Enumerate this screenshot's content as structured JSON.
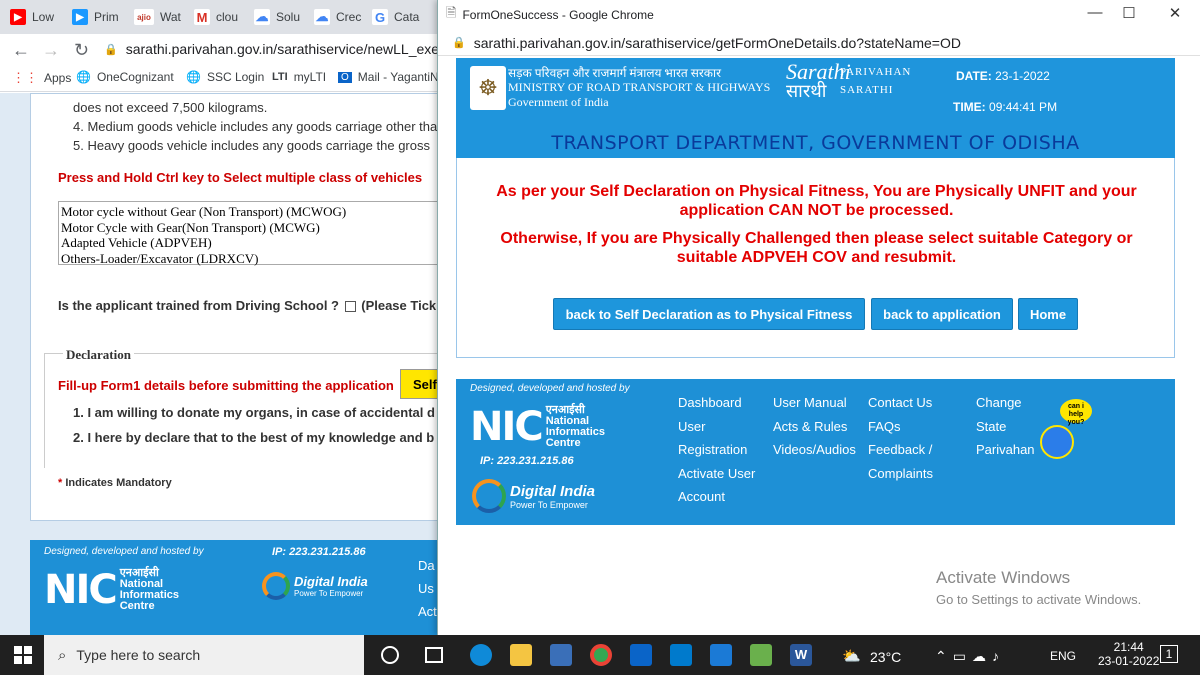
{
  "background_browser": {
    "tabs": [
      {
        "label": "Low",
        "icon": "youtube-icon",
        "color": "#ff0000"
      },
      {
        "label": "Prim",
        "icon": "prime-icon",
        "color": "#1a98ff"
      },
      {
        "label": "Wat",
        "icon": "ajio-icon",
        "color": "#c0392b"
      },
      {
        "label": "clou",
        "icon": "gmail-icon",
        "color": "#d93025"
      },
      {
        "label": "Solu",
        "icon": "cloud-icon",
        "color": "#4285f4"
      },
      {
        "label": "Crec",
        "icon": "cloud-icon",
        "color": "#4285f4"
      },
      {
        "label": "Cata",
        "icon": "google-icon",
        "color": "#4285f4"
      }
    ],
    "url": "sarathi.parivahan.gov.in/sarathiservice/newLL_execut",
    "bookmarks": [
      {
        "label": "Apps",
        "icon": "apps-grid-icon"
      },
      {
        "label": "OneCognizant",
        "icon": "globe-icon"
      },
      {
        "label": "SSC Login",
        "icon": "globe-icon"
      },
      {
        "label": "myLTI",
        "icon": "lti-icon"
      },
      {
        "label": "Mail - YagantiN",
        "icon": "outlook-icon"
      }
    ],
    "page": {
      "lines": [
        "does not exceed 7,500 kilograms.",
        "4. Medium goods vehicle includes any goods carriage other tha",
        "5. Heavy goods vehicle includes any goods carriage the gross"
      ],
      "ctrl_hint": "Press and Hold Ctrl key to Select multiple class of vehicles",
      "vehicle_options": [
        "Motor cycle without Gear (Non Transport) (MCWOG)",
        "Motor Cycle with Gear(Non Transport) (MCWG)",
        "Adapted Vehicle (ADPVEH)",
        "Others-Loader/Excavator (LDRXCV)"
      ],
      "driving_school_q": "Is the applicant trained from Driving School ?",
      "driving_school_hint": "(Please Tick",
      "declaration_title": "Declaration",
      "fillup_note": "Fill-up Form1 details before submitting the application",
      "self_button": "Self",
      "decl_items": [
        "1. I am willing to donate my organs, in case of accidental d",
        "2. I here by declare that to the best of my knowledge and b"
      ],
      "mandatory_star": "*",
      "mandatory_note": "Indicates Mandatory"
    },
    "footer": {
      "designed_by": "Designed, developed and hosted by",
      "nic_short": "NIC",
      "ip": "IP: 223.231.215.86",
      "nic_hindi": "एनआईसी",
      "nic_name": "National Informatics Centre",
      "digital_india": "Digital India",
      "di_tag": "Power To Empower",
      "links_cut": [
        "Da",
        "Us",
        "Act"
      ]
    }
  },
  "popup": {
    "title": "FormOneSuccess - Google Chrome",
    "url": "sarathi.parivahan.gov.in/sarathiservice/getFormOneDetails.do?stateName=OD",
    "header": {
      "hindi_ministry": "सड़क परिवहन और राजमार्ग मंत्रालय भारत सरकार",
      "ministry": "MINISTRY OF ROAD TRANSPORT & HIGHWAYS",
      "gov": "Government of India",
      "sarathi_en": "Sarathi",
      "sarathi_hi": "सारथी",
      "parivahan": "PARIVAHAN",
      "sarathi_caps": "SARATHI",
      "date_label": "DATE:",
      "date_value": "23-1-2022",
      "time_label": "TIME:",
      "time_value": "09:44:41 PM",
      "department": "TRANSPORT DEPARTMENT, GOVERNMENT OF ODISHA"
    },
    "message": {
      "line1": "As per your Self Declaration on Physical Fitness, You are Physically UNFIT and your",
      "line2": "application CAN NOT be processed.",
      "line3": "Otherwise, If you are Physically Challenged then please select suitable Category or",
      "line4": "suitable ADPVEH COV and resubmit."
    },
    "buttons": {
      "back_self": "back to Self Declaration as to Physical Fitness",
      "back_app": "back to application",
      "home": "Home"
    },
    "footer": {
      "designed_by": "Designed, developed and hosted by",
      "nic_short": "NIC",
      "ip": "IP: 223.231.215.86",
      "nic_hindi": "एनआईसी",
      "nic_name": "National Informatics Centre",
      "digital_india": "Digital India",
      "di_tag": "Power To Empower",
      "col1": [
        "Dashboard",
        "User",
        "Registration",
        "Activate User",
        "Account"
      ],
      "col2": [
        "User Manual",
        "Acts & Rules",
        "Videos/Audios"
      ],
      "col3": [
        "Contact Us",
        "FAQs",
        "Feedback /",
        "Complaints"
      ],
      "col4": [
        "Change",
        "State",
        "Parivahan"
      ],
      "help_bubble": "can i help you?"
    }
  },
  "watermark": {
    "title": "Activate Windows",
    "sub": "Go to Settings to activate Windows."
  },
  "taskbar": {
    "search_placeholder": "Type here to search",
    "weather": "23°C",
    "lang": "ENG",
    "time": "21:44",
    "date": "23-01-2022",
    "notifications": "1"
  }
}
